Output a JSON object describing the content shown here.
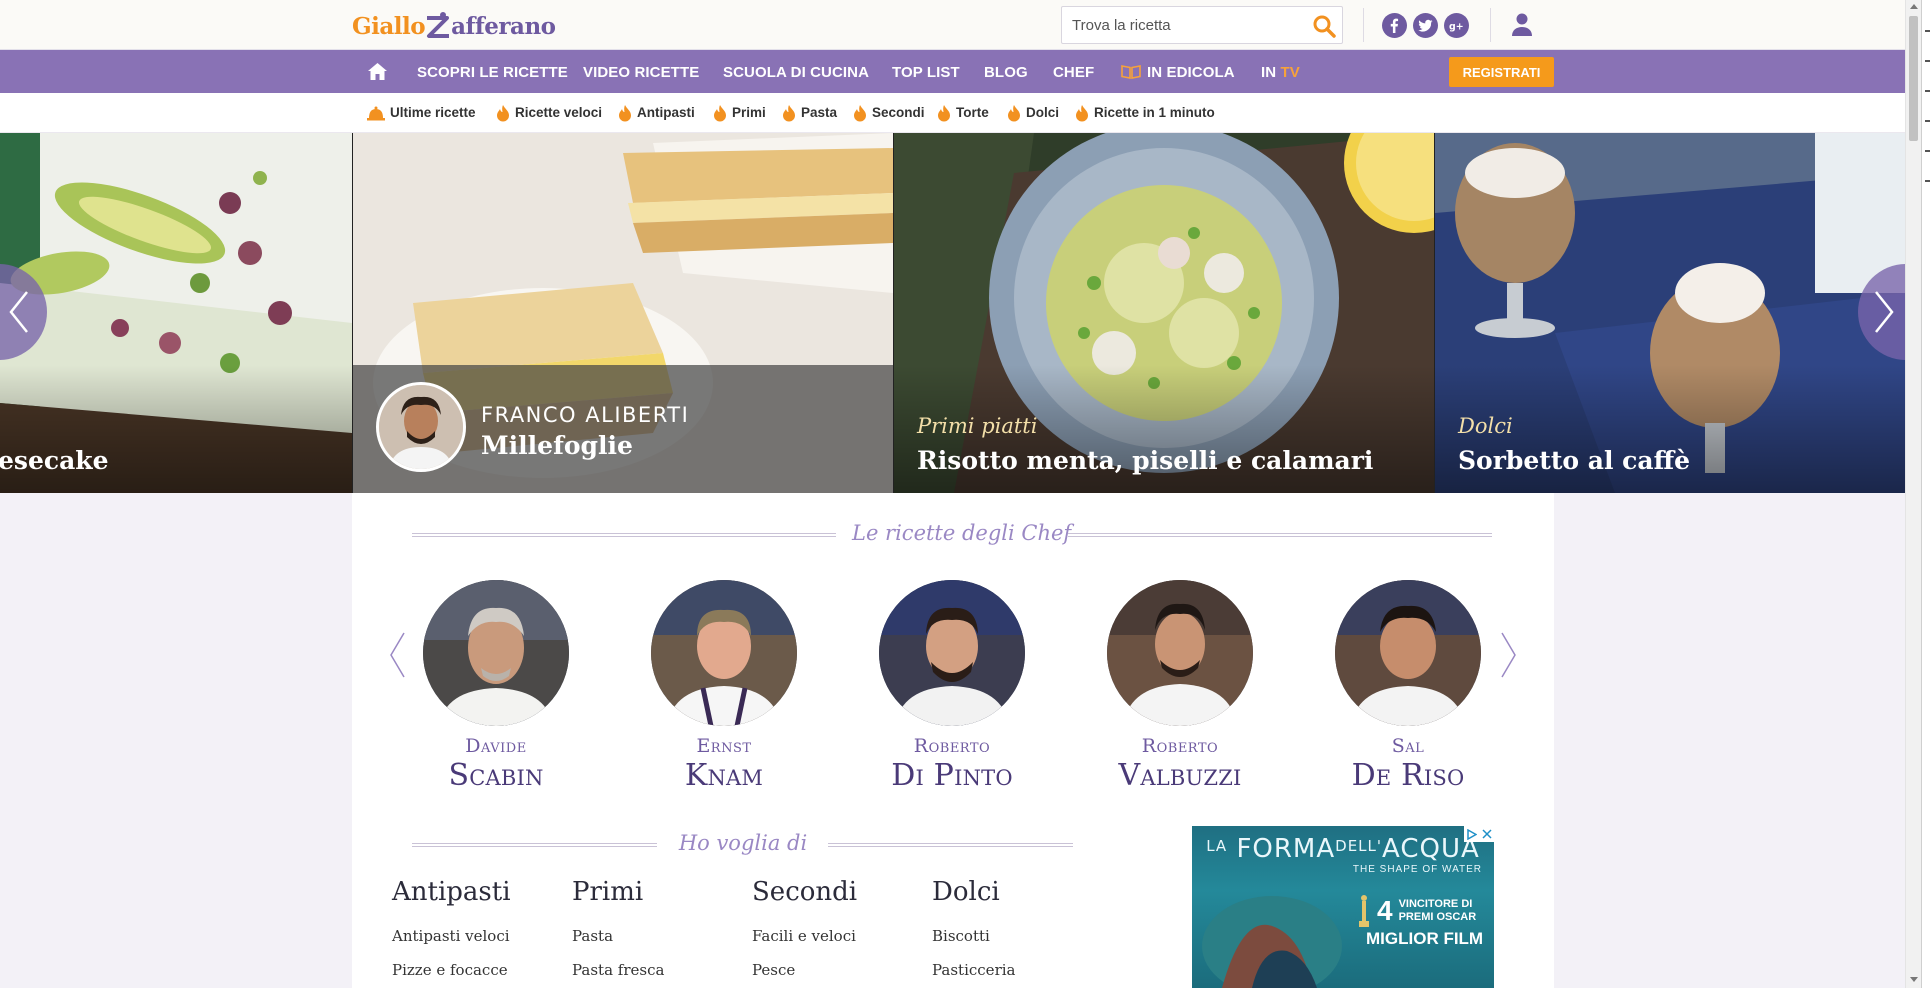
{
  "header": {
    "logo": {
      "part1": "Giallo",
      "part2": "afferano"
    },
    "search": {
      "placeholder": "Trova la ricetta",
      "icon": "search-icon"
    },
    "social": [
      "facebook-icon",
      "twitter-icon",
      "google-plus-icon"
    ],
    "user_icon": "user-icon"
  },
  "nav": {
    "home_icon": "home-icon",
    "items": [
      "SCOPRI LE RICETTE",
      "VIDEO RICETTE",
      "SCUOLA DI CUCINA",
      "TOP LIST",
      "BLOG",
      "CHEF",
      "IN EDICOLA"
    ],
    "tv": {
      "prefix": "IN",
      "suffix": "TV"
    },
    "register": "REGISTRATI"
  },
  "subnav": [
    "Ultime ricette",
    "Ricette veloci",
    "Antipasti",
    "Primi",
    "Pasta",
    "Secondi",
    "Torte",
    "Dolci",
    "Ricette in 1 minuto"
  ],
  "hero": {
    "slides": [
      {
        "title": "esecake"
      },
      {
        "chef": "FRANCO ALIBERTI",
        "title": "Millefoglie"
      },
      {
        "category": "Primi piatti",
        "title": "Risotto menta, piselli e calamari"
      },
      {
        "category": "Dolci",
        "title": "Sorbetto al caffè"
      }
    ]
  },
  "chefs_section": {
    "title": "Le ricette degli Chef",
    "chefs": [
      {
        "first": "Davide",
        "last": "Scabin"
      },
      {
        "first": "Ernst",
        "last": "Knam"
      },
      {
        "first": "Roberto",
        "last": "Di Pinto"
      },
      {
        "first": "Roberto",
        "last": "Valbuzzi"
      },
      {
        "first": "Sal",
        "last": "De Riso"
      }
    ]
  },
  "categories_section": {
    "title": "Ho voglia di",
    "columns": [
      {
        "head": "Antipasti",
        "links": [
          "Antipasti veloci",
          "Pizze e focacce"
        ]
      },
      {
        "head": "Primi",
        "links": [
          "Pasta",
          "Pasta fresca"
        ]
      },
      {
        "head": "Secondi",
        "links": [
          "Facili e veloci",
          "Pesce"
        ]
      },
      {
        "head": "Dolci",
        "links": [
          "Biscotti",
          "Pasticceria"
        ]
      }
    ]
  },
  "ad": {
    "title_a": "LA",
    "title_b": "FORMA",
    "title_c": "DELL'",
    "title_d": "ACQUA",
    "subtitle": "THE SHAPE OF WATER",
    "count": "4",
    "line1": "VINCITORE DI",
    "line2": "PREMI OSCAR",
    "line3": "MIGLIOR FILM"
  },
  "colors": {
    "brand_purple": "#8972b5",
    "brand_orange": "#f59a1b"
  }
}
